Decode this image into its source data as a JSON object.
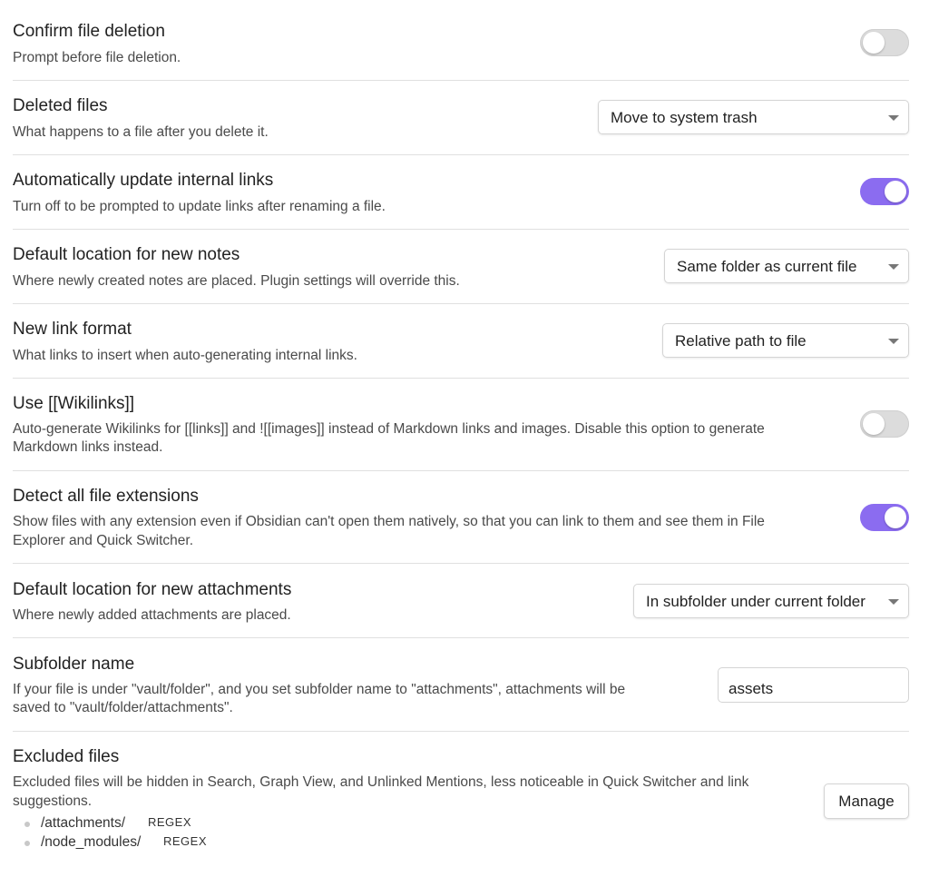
{
  "settings": [
    {
      "title": "Confirm file deletion",
      "desc": "Prompt before file deletion.",
      "toggle": false
    },
    {
      "title": "Deleted files",
      "desc": "What happens to a file after you delete it.",
      "dropdown": "Move to system trash"
    },
    {
      "title": "Automatically update internal links",
      "desc": "Turn off to be prompted to update links after renaming a file.",
      "toggle": true
    },
    {
      "title": "Default location for new notes",
      "desc": "Where newly created notes are placed. Plugin settings will override this.",
      "dropdown": "Same folder as current file"
    },
    {
      "title": "New link format",
      "desc": "What links to insert when auto-generating internal links.",
      "dropdown": "Relative path to file"
    },
    {
      "title": "Use [[Wikilinks]]",
      "desc_line1": "Auto-generate Wikilinks for [[links]] and ![[images]] instead of Markdown links and images. Disable this option to generate",
      "desc_line2": "Markdown links instead.",
      "toggle": false
    },
    {
      "title": "Detect all file extensions",
      "desc_line1": "Show files with any extension even if Obsidian can't open them natively, so that you can link to them and see them in File",
      "desc_line2": "Explorer and Quick Switcher.",
      "toggle": true
    },
    {
      "title": "Default location for new attachments",
      "desc": "Where newly added attachments are placed.",
      "dropdown": "In subfolder under current folder"
    },
    {
      "title": "Subfolder name",
      "desc_line1": "If your file is under \"vault/folder\", and you set subfolder name to \"attachments\", attachments will be",
      "desc_line2": "saved to \"vault/folder/attachments\".",
      "input_value": "assets"
    },
    {
      "title": "Excluded files",
      "desc_line1": "Excluded files will be hidden in Search, Graph View, and Unlinked Mentions, less noticeable in Quick Switcher and link",
      "desc_line2": "suggestions.",
      "button": "Manage",
      "excluded": [
        {
          "path": "/attachments/",
          "tag": "REGEX"
        },
        {
          "path": "/node_modules/",
          "tag": "REGEX"
        }
      ]
    }
  ],
  "colors": {
    "toggle_on": "#8b6cf0",
    "toggle_off": "#dcdcdc",
    "separator": "#e0e0e0"
  }
}
